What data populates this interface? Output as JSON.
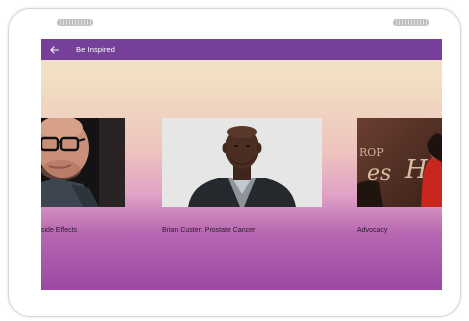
{
  "app": {
    "title": "Be Inspired",
    "back_icon": "arrow-left-icon"
  },
  "videos": [
    {
      "caption": "side Effects"
    },
    {
      "caption": "Brian Custer: Prostate Cancer"
    },
    {
      "caption": "Advocacy"
    }
  ],
  "colors": {
    "appbar": "#76409a",
    "gradient_top": "#f3e5c9",
    "gradient_mid": "#eec3bd",
    "gradient_bottom": "#9b4aa3"
  }
}
